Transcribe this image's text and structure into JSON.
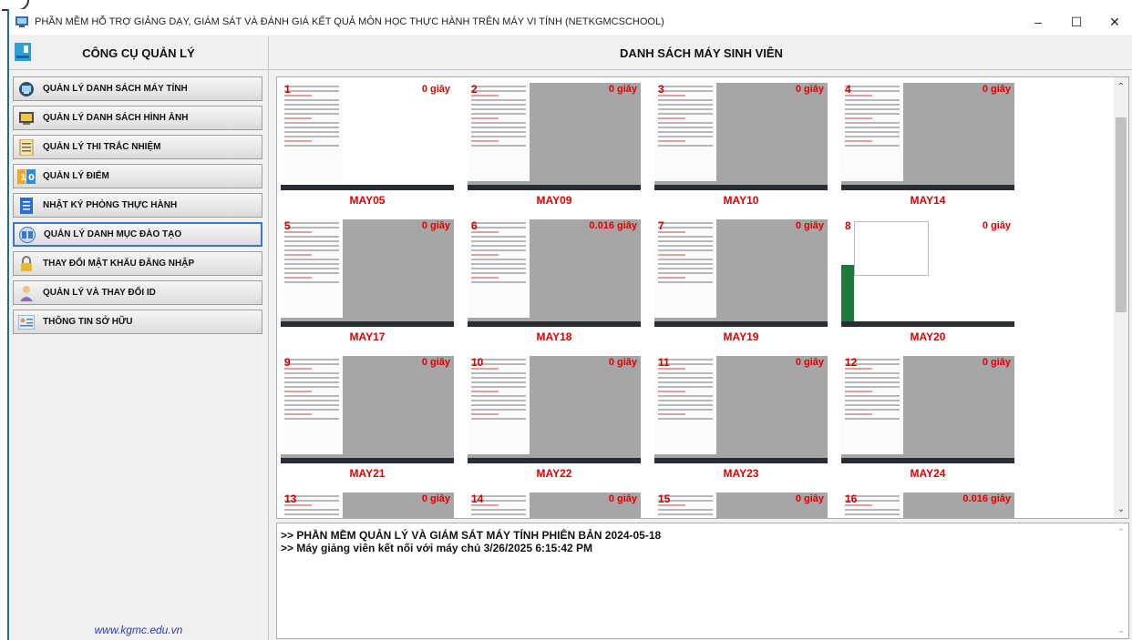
{
  "window": {
    "title": "PHẦN MỀM HỖ TRỢ GIẢNG DẠY, GIÁM SÁT VÀ ĐÁNH GIÁ KẾT QUẢ MÔN HỌC THỰC HÀNH TRÊN MÁY VI TÍNH (NETKGMCSCHOOL)",
    "minimize": "–",
    "maximize": "☐",
    "close": "✕"
  },
  "sidebar": {
    "header": "CÔNG CỤ QUẢN LÝ",
    "items": [
      {
        "label": "QUẢN LÝ DANH SÁCH MÁY TÍNH",
        "icon": "monitor-icon"
      },
      {
        "label": "QUẢN LÝ DANH SÁCH HÌNH ẢNH",
        "icon": "image-icon"
      },
      {
        "label": "QUẢN LÝ THI TRẮC NHIỆM",
        "icon": "quiz-icon"
      },
      {
        "label": "QUẢN LÝ ĐIỂM",
        "icon": "score-icon"
      },
      {
        "label": "NHẬT KÝ PHÒNG THỰC HÀNH",
        "icon": "notebook-icon"
      },
      {
        "label": "QUẢN LÝ DANH MỤC ĐÀO TẠO",
        "icon": "book-icon"
      },
      {
        "label": "THAY ĐỔI MẬT KHẨU ĐĂNG NHẬP",
        "icon": "lock-icon"
      },
      {
        "label": "QUẢN LÝ VÀ THAY ĐỔI ID",
        "icon": "user-icon"
      },
      {
        "label": "THÔNG TIN SỞ HỮU",
        "icon": "info-icon"
      }
    ],
    "website": "www.kgmc.edu.vn"
  },
  "main": {
    "header": "DANH SÁCH MÁY SINH VIÊN",
    "machines": [
      {
        "num": "1",
        "name": "MAY05",
        "time": "0 giây"
      },
      {
        "num": "2",
        "name": "MAY09",
        "time": "0 giây"
      },
      {
        "num": "3",
        "name": "MAY10",
        "time": "0 giây"
      },
      {
        "num": "4",
        "name": "MAY14",
        "time": "0 giây"
      },
      {
        "num": "5",
        "name": "MAY17",
        "time": "0 giây"
      },
      {
        "num": "6",
        "name": "MAY18",
        "time": "0.016 giây"
      },
      {
        "num": "7",
        "name": "MAY19",
        "time": "0 giây"
      },
      {
        "num": "8",
        "name": "MAY20",
        "time": "0 giây"
      },
      {
        "num": "9",
        "name": "MAY21",
        "time": "0 giây"
      },
      {
        "num": "10",
        "name": "MAY22",
        "time": "0 giây"
      },
      {
        "num": "11",
        "name": "MAY23",
        "time": "0 giây"
      },
      {
        "num": "12",
        "name": "MAY24",
        "time": "0 giây"
      },
      {
        "num": "13",
        "name": "",
        "time": "0 giây"
      },
      {
        "num": "14",
        "name": "",
        "time": "0 giây"
      },
      {
        "num": "15",
        "name": "",
        "time": "0 giây"
      },
      {
        "num": "16",
        "name": "",
        "time": "0.016 giây"
      }
    ]
  },
  "log": {
    "lines": [
      ">> PHẦN MỀM QUẢN LÝ VÀ GIÁM SÁT MÁY TÍNH PHIÊN BẢN 2024-05-18",
      ">> Máy giảng viên kết nối với máy chủ 3/26/2025 6:15:42 PM"
    ]
  },
  "colors": {
    "accent_red": "#e00000",
    "link_blue": "#2b3dbb",
    "active_border": "#3b79c8"
  }
}
